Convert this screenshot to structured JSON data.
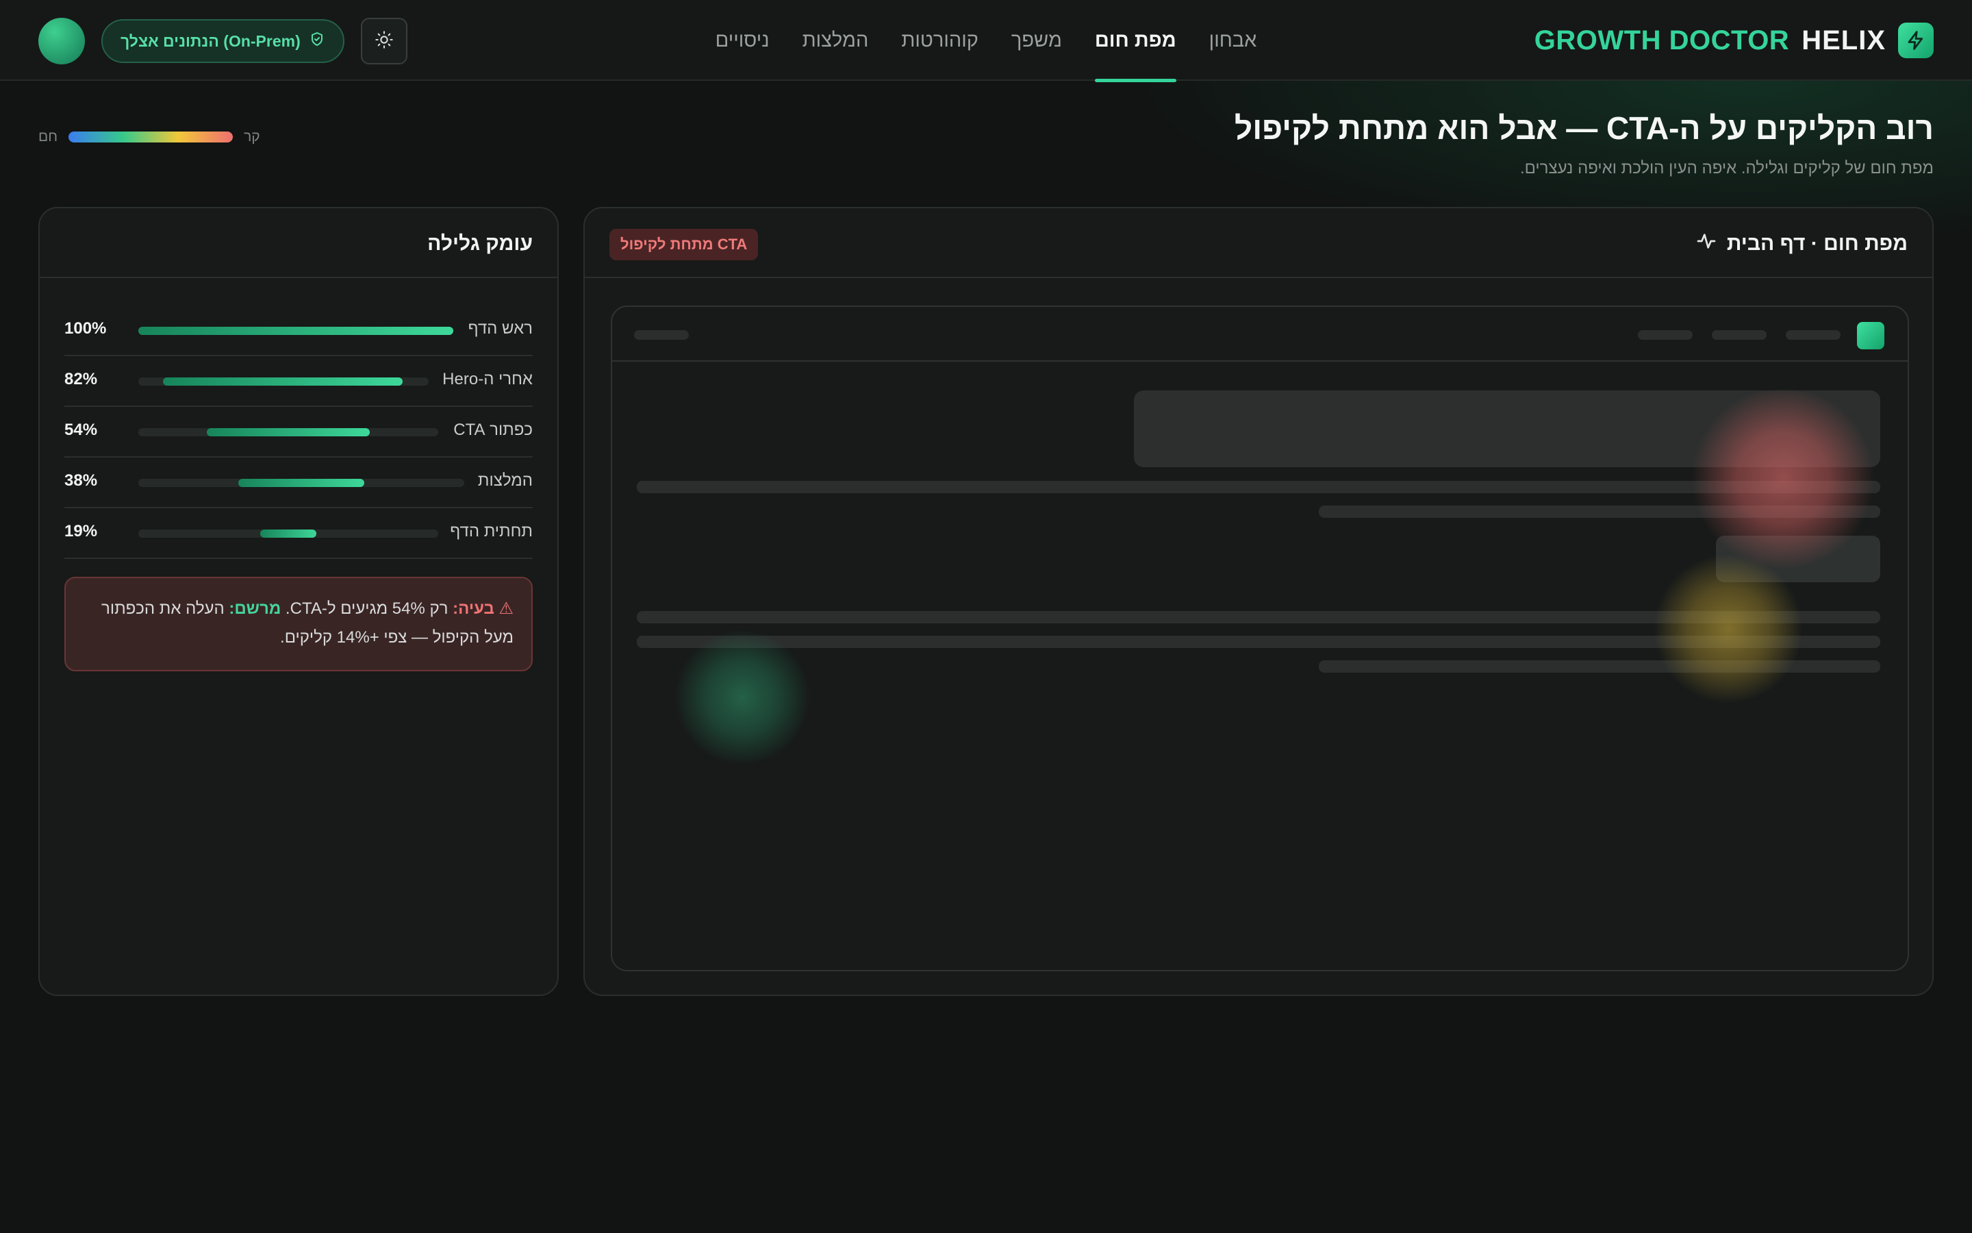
{
  "brand": {
    "name_part1": "HELIX",
    "name_part2": "GROWTH DOCTOR"
  },
  "nav": {
    "items": [
      {
        "label": "אבחון",
        "active": false
      },
      {
        "label": "מפת חום",
        "active": true
      },
      {
        "label": "משפך",
        "active": false
      },
      {
        "label": "קוהורטות",
        "active": false
      },
      {
        "label": "המלצות",
        "active": false
      },
      {
        "label": "ניסויים",
        "active": false
      }
    ]
  },
  "header": {
    "onprem_badge": "הנתונים אצלך (On-Prem)"
  },
  "page": {
    "title": "רוב הקליקים על ה-CTA — אבל הוא מתחת לקיפול",
    "subtitle": "מפת חום של קליקים וגלילה. איפה העין הולכת ואיפה נעצרים."
  },
  "legend": {
    "cold": "קר",
    "hot": "חם"
  },
  "heatmap_card": {
    "title": "מפת חום · דף הבית",
    "badge": "CTA מתחת לקיפול",
    "spots": [
      {
        "zone": "hero-cta",
        "intensity": "hot",
        "color": "#e06c6c"
      },
      {
        "zone": "secondary-button",
        "intensity": "warm",
        "color": "#d6b43a"
      },
      {
        "zone": "lower-left",
        "intensity": "cool",
        "color": "#2f9a6e"
      }
    ]
  },
  "scroll_card": {
    "title": "עומק גלילה",
    "rows": [
      {
        "label": "ראש הדף",
        "pct_label": "100%",
        "value": 100
      },
      {
        "label": "אחרי ה-Hero",
        "pct_label": "82%",
        "value": 82
      },
      {
        "label": "כפתור CTA",
        "pct_label": "54%",
        "value": 54
      },
      {
        "label": "המלצות",
        "pct_label": "38%",
        "value": 38
      },
      {
        "label": "תחתית הדף",
        "pct_label": "19%",
        "value": 19
      }
    ],
    "alert": {
      "icon": "⚠",
      "problem_label": "בעיה:",
      "problem_text": " רק 54% מגיעים ל-CTA. ",
      "fix_label": "מרשם:",
      "fix_text": " העלה את הכפתור מעל הקיפול — צפי +14% קליקים."
    }
  },
  "colors": {
    "accent": "#35d49a",
    "danger": "#f07a7a",
    "background": "#111413"
  }
}
